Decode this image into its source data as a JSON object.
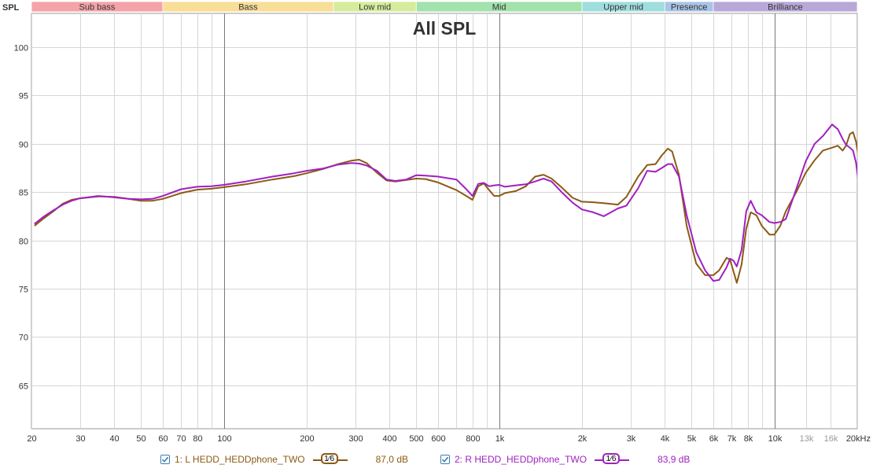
{
  "colors": {
    "grid": "#d6d6d6",
    "grid_major": "#7a7a7a",
    "axis_text": "#333333",
    "series_left": "#8b5a14",
    "series_right": "#a020c0"
  },
  "bands": [
    {
      "label": "Sub bass",
      "from": 20,
      "to": 60,
      "color": "#f4a3a8"
    },
    {
      "label": "Bass",
      "from": 60,
      "to": 250,
      "color": "#f8de96"
    },
    {
      "label": "Low mid",
      "from": 250,
      "to": 500,
      "color": "#d6ec9c"
    },
    {
      "label": "Mid",
      "from": 500,
      "to": 2000,
      "color": "#a2e2ac"
    },
    {
      "label": "Upper mid",
      "from": 2000,
      "to": 4000,
      "color": "#a0dede"
    },
    {
      "label": "Presence",
      "from": 4000,
      "to": 6000,
      "color": "#a8c4e6"
    },
    {
      "label": "Brilliance",
      "from": 6000,
      "to": 20000,
      "color": "#b8a8d8"
    }
  ],
  "legend": [
    {
      "check_icon": "checkmark-icon",
      "name": "1: L HEDD_HEDDphone_TWO",
      "smoothing": "1⁄6",
      "value": "87,0 dB",
      "color": "#8b5a14"
    },
    {
      "check_icon": "checkmark-icon",
      "name": "2: R HEDD_HEDDphone_TWO",
      "smoothing": "1⁄6",
      "value": "83,9 dB",
      "color": "#a020c0"
    }
  ],
  "chart_data": {
    "type": "line",
    "title": "All SPL",
    "ylabel": "SPL",
    "xscale": "log",
    "xlim": [
      20,
      20000
    ],
    "ylim": [
      60.5,
      103.5
    ],
    "grid": true,
    "yticks": [
      65,
      70,
      75,
      80,
      85,
      90,
      95,
      100
    ],
    "xticks": [
      {
        "value": 20,
        "label": "20",
        "major": false
      },
      {
        "value": 30,
        "label": "30",
        "major": false
      },
      {
        "value": 40,
        "label": "40",
        "major": false
      },
      {
        "value": 50,
        "label": "50",
        "major": false
      },
      {
        "value": 60,
        "label": "60",
        "major": false
      },
      {
        "value": 70,
        "label": "70",
        "major": false
      },
      {
        "value": 80,
        "label": "80",
        "major": false
      },
      {
        "value": 90,
        "label": "",
        "major": false
      },
      {
        "value": 100,
        "label": "100",
        "major": true
      },
      {
        "value": 200,
        "label": "200",
        "major": false
      },
      {
        "value": 300,
        "label": "300",
        "major": false
      },
      {
        "value": 400,
        "label": "400",
        "major": false
      },
      {
        "value": 500,
        "label": "500",
        "major": false
      },
      {
        "value": 600,
        "label": "600",
        "major": false
      },
      {
        "value": 700,
        "label": "",
        "major": false
      },
      {
        "value": 800,
        "label": "800",
        "major": false
      },
      {
        "value": 900,
        "label": "",
        "major": false
      },
      {
        "value": 1000,
        "label": "1k",
        "major": true
      },
      {
        "value": 2000,
        "label": "2k",
        "major": false
      },
      {
        "value": 3000,
        "label": "3k",
        "major": false
      },
      {
        "value": 4000,
        "label": "4k",
        "major": false
      },
      {
        "value": 5000,
        "label": "5k",
        "major": false
      },
      {
        "value": 6000,
        "label": "6k",
        "major": false
      },
      {
        "value": 7000,
        "label": "7k",
        "major": false
      },
      {
        "value": 8000,
        "label": "8k",
        "major": false
      },
      {
        "value": 9000,
        "label": "",
        "major": false
      },
      {
        "value": 10000,
        "label": "10k",
        "major": true
      },
      {
        "value": 13000,
        "label": "13k",
        "major": false,
        "faint": true
      },
      {
        "value": 16000,
        "label": "16k",
        "major": false,
        "faint": true
      },
      {
        "value": 20000,
        "label": "20kHz",
        "major": false
      }
    ],
    "series": [
      {
        "name": "1: L HEDD_HEDDphone_TWO",
        "color": "#8b5a14",
        "points": [
          [
            20.5,
            81.5
          ],
          [
            22,
            82.2
          ],
          [
            24,
            83
          ],
          [
            26,
            83.8
          ],
          [
            28,
            84.2
          ],
          [
            30,
            84.35
          ],
          [
            35,
            84.55
          ],
          [
            40,
            84.5
          ],
          [
            45,
            84.3
          ],
          [
            50,
            84.1
          ],
          [
            55,
            84.1
          ],
          [
            60,
            84.3
          ],
          [
            70,
            84.9
          ],
          [
            80,
            85.25
          ],
          [
            90,
            85.35
          ],
          [
            100,
            85.5
          ],
          [
            120,
            85.8
          ],
          [
            150,
            86.3
          ],
          [
            180,
            86.65
          ],
          [
            200,
            86.95
          ],
          [
            230,
            87.4
          ],
          [
            260,
            87.9
          ],
          [
            290,
            88.25
          ],
          [
            310,
            88.35
          ],
          [
            330,
            88.0
          ],
          [
            360,
            87.0
          ],
          [
            390,
            86.2
          ],
          [
            420,
            86.1
          ],
          [
            460,
            86.25
          ],
          [
            500,
            86.4
          ],
          [
            540,
            86.35
          ],
          [
            600,
            86.0
          ],
          [
            700,
            85.2
          ],
          [
            760,
            84.6
          ],
          [
            800,
            84.2
          ],
          [
            840,
            85.6
          ],
          [
            880,
            85.9
          ],
          [
            920,
            85.2
          ],
          [
            960,
            84.6
          ],
          [
            1000,
            84.6
          ],
          [
            1050,
            84.9
          ],
          [
            1150,
            85.1
          ],
          [
            1250,
            85.6
          ],
          [
            1350,
            86.6
          ],
          [
            1450,
            86.8
          ],
          [
            1550,
            86.4
          ],
          [
            1700,
            85.4
          ],
          [
            1850,
            84.4
          ],
          [
            2000,
            84.0
          ],
          [
            2200,
            83.95
          ],
          [
            2400,
            83.85
          ],
          [
            2700,
            83.7
          ],
          [
            2900,
            84.5
          ],
          [
            3200,
            86.6
          ],
          [
            3450,
            87.8
          ],
          [
            3700,
            87.9
          ],
          [
            3900,
            88.8
          ],
          [
            4100,
            89.5
          ],
          [
            4250,
            89.2
          ],
          [
            4500,
            86.8
          ],
          [
            4800,
            81.5
          ],
          [
            5200,
            77.6
          ],
          [
            5600,
            76.4
          ],
          [
            6000,
            76.4
          ],
          [
            6300,
            76.9
          ],
          [
            6700,
            78.2
          ],
          [
            6900,
            78.0
          ],
          [
            7100,
            76.8
          ],
          [
            7300,
            75.6
          ],
          [
            7600,
            77.5
          ],
          [
            7900,
            81.2
          ],
          [
            8200,
            82.9
          ],
          [
            8600,
            82.6
          ],
          [
            9000,
            81.5
          ],
          [
            9600,
            80.6
          ],
          [
            10000,
            80.6
          ],
          [
            10500,
            81.5
          ],
          [
            11000,
            83.0
          ],
          [
            12000,
            85.0
          ],
          [
            13000,
            87.0
          ],
          [
            14000,
            88.3
          ],
          [
            15000,
            89.3
          ],
          [
            16200,
            89.6
          ],
          [
            17000,
            89.8
          ],
          [
            17700,
            89.3
          ],
          [
            18200,
            89.8
          ],
          [
            18800,
            91.0
          ],
          [
            19300,
            91.2
          ],
          [
            19800,
            90.2
          ],
          [
            20300,
            88.3
          ],
          [
            20700,
            87.2
          ],
          [
            21000,
            87.1
          ]
        ]
      },
      {
        "name": "2: R HEDD_HEDDphone_TWO",
        "color": "#a020c0",
        "points": [
          [
            20.5,
            81.7
          ],
          [
            22,
            82.4
          ],
          [
            24,
            83.1
          ],
          [
            26,
            83.7
          ],
          [
            28,
            84.1
          ],
          [
            30,
            84.35
          ],
          [
            35,
            84.6
          ],
          [
            40,
            84.45
          ],
          [
            45,
            84.3
          ],
          [
            50,
            84.25
          ],
          [
            55,
            84.3
          ],
          [
            60,
            84.6
          ],
          [
            70,
            85.3
          ],
          [
            80,
            85.55
          ],
          [
            90,
            85.6
          ],
          [
            100,
            85.75
          ],
          [
            120,
            86.1
          ],
          [
            150,
            86.6
          ],
          [
            180,
            86.95
          ],
          [
            200,
            87.2
          ],
          [
            230,
            87.45
          ],
          [
            260,
            87.85
          ],
          [
            290,
            88.0
          ],
          [
            310,
            87.95
          ],
          [
            330,
            87.75
          ],
          [
            360,
            87.2
          ],
          [
            390,
            86.3
          ],
          [
            420,
            86.15
          ],
          [
            460,
            86.3
          ],
          [
            500,
            86.75
          ],
          [
            540,
            86.7
          ],
          [
            600,
            86.6
          ],
          [
            700,
            86.3
          ],
          [
            760,
            85.3
          ],
          [
            800,
            84.6
          ],
          [
            840,
            85.85
          ],
          [
            880,
            85.95
          ],
          [
            920,
            85.6
          ],
          [
            960,
            85.7
          ],
          [
            1000,
            85.75
          ],
          [
            1050,
            85.55
          ],
          [
            1150,
            85.7
          ],
          [
            1250,
            85.8
          ],
          [
            1350,
            86.1
          ],
          [
            1450,
            86.4
          ],
          [
            1550,
            86.1
          ],
          [
            1700,
            84.9
          ],
          [
            1850,
            83.9
          ],
          [
            2000,
            83.2
          ],
          [
            2200,
            82.9
          ],
          [
            2400,
            82.5
          ],
          [
            2700,
            83.3
          ],
          [
            2900,
            83.6
          ],
          [
            3200,
            85.4
          ],
          [
            3450,
            87.2
          ],
          [
            3700,
            87.1
          ],
          [
            3900,
            87.5
          ],
          [
            4100,
            87.9
          ],
          [
            4250,
            87.9
          ],
          [
            4500,
            86.6
          ],
          [
            4800,
            82.6
          ],
          [
            5200,
            78.8
          ],
          [
            5600,
            76.9
          ],
          [
            6000,
            75.8
          ],
          [
            6300,
            75.9
          ],
          [
            6700,
            77.2
          ],
          [
            6900,
            78.1
          ],
          [
            7100,
            77.9
          ],
          [
            7300,
            77.3
          ],
          [
            7600,
            79.0
          ],
          [
            7900,
            83.0
          ],
          [
            8200,
            84.1
          ],
          [
            8600,
            82.9
          ],
          [
            9000,
            82.6
          ],
          [
            9600,
            81.9
          ],
          [
            10000,
            81.8
          ],
          [
            10500,
            81.9
          ],
          [
            11000,
            82.2
          ],
          [
            12000,
            85.3
          ],
          [
            13000,
            88.2
          ],
          [
            14000,
            90.0
          ],
          [
            15000,
            90.8
          ],
          [
            16200,
            92.0
          ],
          [
            17000,
            91.5
          ],
          [
            17700,
            90.5
          ],
          [
            18200,
            89.9
          ],
          [
            18800,
            89.6
          ],
          [
            19300,
            89.3
          ],
          [
            19800,
            88.0
          ],
          [
            20300,
            85.5
          ],
          [
            20700,
            84.2
          ],
          [
            21000,
            84.0
          ]
        ]
      }
    ]
  }
}
